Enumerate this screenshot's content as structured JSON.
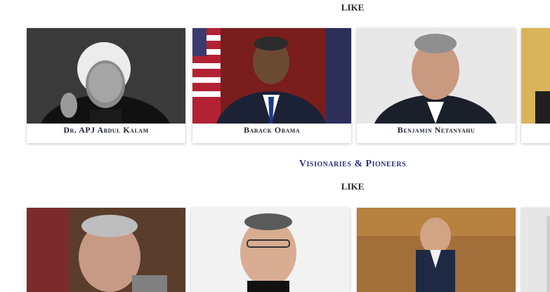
{
  "header": {
    "like_top": "LIKE"
  },
  "row1": {
    "cards": [
      {
        "caption": "Dr. APJ Abdul Kalam"
      },
      {
        "caption": "Barack Obama"
      },
      {
        "caption": "Benjamin Netanyahu"
      },
      {
        "caption": ""
      }
    ]
  },
  "section2": {
    "title": "Visionaries & Pioneers",
    "like": "LIKE"
  },
  "row2": {
    "cards": [
      {
        "caption": ""
      },
      {
        "caption": ""
      },
      {
        "caption": ""
      },
      {
        "caption": ""
      }
    ]
  },
  "colors": {
    "title_blue": "#2c3278",
    "caption_dark": "#1f2533"
  }
}
